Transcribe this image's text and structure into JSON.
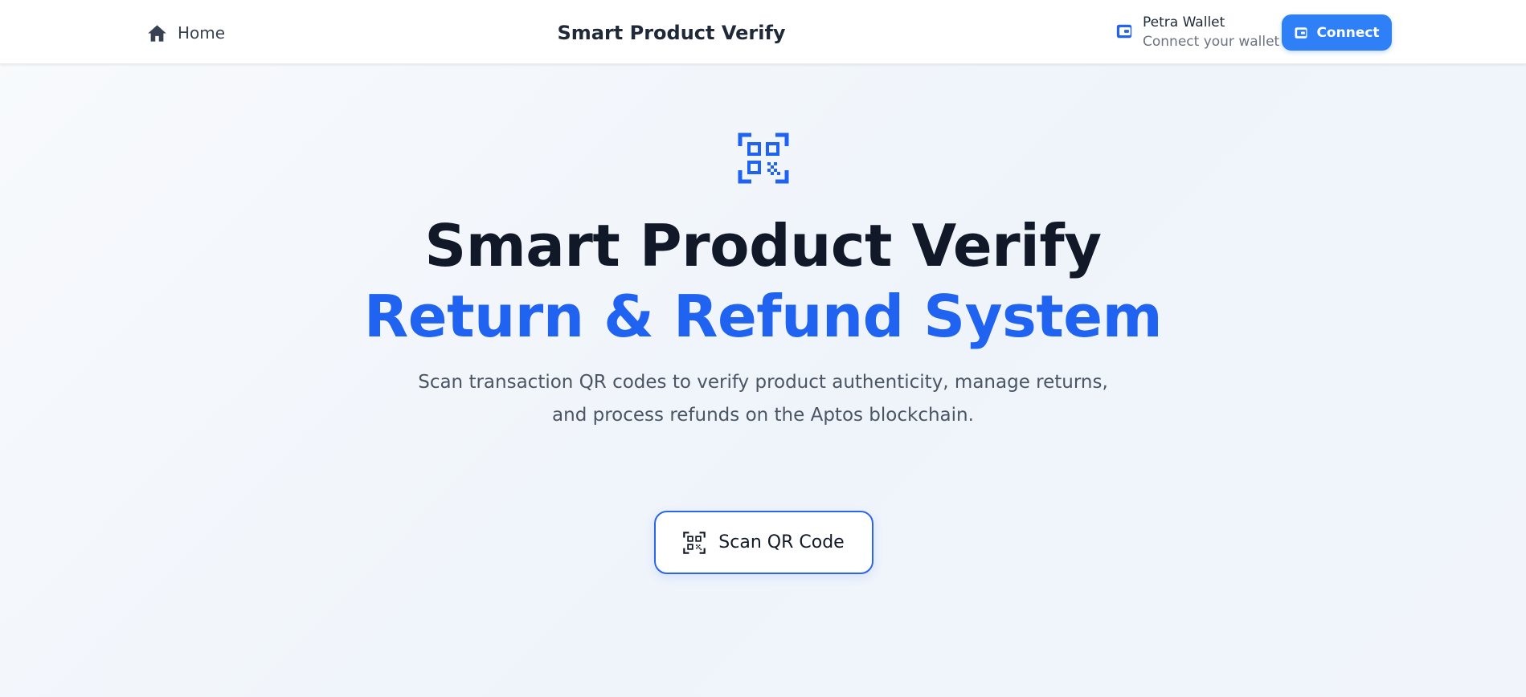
{
  "nav": {
    "home_label": "Home",
    "brand_title": "Smart Product Verify",
    "wallet_name": "Petra Wallet",
    "wallet_status": "Connect your wallet",
    "connect_label": "Connect"
  },
  "hero": {
    "title_line_1": "Smart Product Verify",
    "title_line_2": "Return & Refund System",
    "description_line_1": "Scan transaction QR codes to verify product authenticity, manage returns,",
    "description_line_2": "and process refunds on the Aptos blockchain.",
    "scan_button_label": "Scan QR Code"
  },
  "icons": {
    "home": "home-icon",
    "wallet": "wallet-icon",
    "connect": "wallet-icon",
    "hero": "qr-scan-icon",
    "scan_button": "qr-scan-icon"
  },
  "colors": {
    "accent": "#2f80f6",
    "title_highlight": "#1f63f0",
    "title_dark": "#111827",
    "scan_button_border": "#2c66e8",
    "text_muted": "#4b5563"
  }
}
